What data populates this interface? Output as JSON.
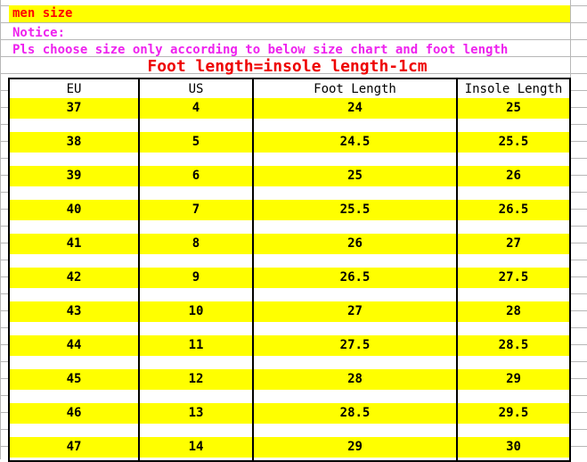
{
  "banner": {
    "title": "men size"
  },
  "notice": {
    "heading": "Notice:",
    "body": "Pls choose size only according to below size chart and foot length"
  },
  "formula": {
    "text": "Foot length=insole length-1cm"
  },
  "colors": {
    "banner_background": "#ffff00",
    "banner_text": "#ff0000",
    "notice_text": "#ee22ee",
    "formula_text": "#ee0000",
    "row_highlight": "#ffff00",
    "table_border": "#000000",
    "gridline": "#b7b7b7"
  },
  "table": {
    "headers": [
      "EU",
      "US",
      "Foot Length",
      "Insole Length"
    ],
    "rows": [
      [
        "37",
        "4",
        "24",
        "25"
      ],
      [
        "38",
        "5",
        "24.5",
        "25.5"
      ],
      [
        "39",
        "6",
        "25",
        "26"
      ],
      [
        "40",
        "7",
        "25.5",
        "26.5"
      ],
      [
        "41",
        "8",
        "26",
        "27"
      ],
      [
        "42",
        "9",
        "26.5",
        "27.5"
      ],
      [
        "43",
        "10",
        "27",
        "28"
      ],
      [
        "44",
        "11",
        "27.5",
        "28.5"
      ],
      [
        "45",
        "12",
        "28",
        "29"
      ],
      [
        "46",
        "13",
        "28.5",
        "29.5"
      ],
      [
        "47",
        "14",
        "29",
        "30"
      ]
    ]
  },
  "chart_data": {
    "type": "table",
    "title": "men size",
    "columns": [
      "EU",
      "US",
      "Foot Length",
      "Insole Length"
    ],
    "units": {
      "Foot Length": "cm",
      "Insole Length": "cm"
    },
    "rows": [
      {
        "EU": 37,
        "US": 4,
        "Foot Length": 24,
        "Insole Length": 25
      },
      {
        "EU": 38,
        "US": 5,
        "Foot Length": 24.5,
        "Insole Length": 25.5
      },
      {
        "EU": 39,
        "US": 6,
        "Foot Length": 25,
        "Insole Length": 26
      },
      {
        "EU": 40,
        "US": 7,
        "Foot Length": 25.5,
        "Insole Length": 26.5
      },
      {
        "EU": 41,
        "US": 8,
        "Foot Length": 26,
        "Insole Length": 27
      },
      {
        "EU": 42,
        "US": 9,
        "Foot Length": 26.5,
        "Insole Length": 27.5
      },
      {
        "EU": 43,
        "US": 10,
        "Foot Length": 27,
        "Insole Length": 28
      },
      {
        "EU": 44,
        "US": 11,
        "Foot Length": 27.5,
        "Insole Length": 28.5
      },
      {
        "EU": 45,
        "US": 12,
        "Foot Length": 28,
        "Insole Length": 29
      },
      {
        "EU": 46,
        "US": 13,
        "Foot Length": 28.5,
        "Insole Length": 29.5
      },
      {
        "EU": 47,
        "US": 14,
        "Foot Length": 29,
        "Insole Length": 30
      }
    ],
    "annotations": [
      "Notice:",
      "Pls choose size only according to below size chart and foot length",
      "Foot length=insole length-1cm"
    ]
  }
}
